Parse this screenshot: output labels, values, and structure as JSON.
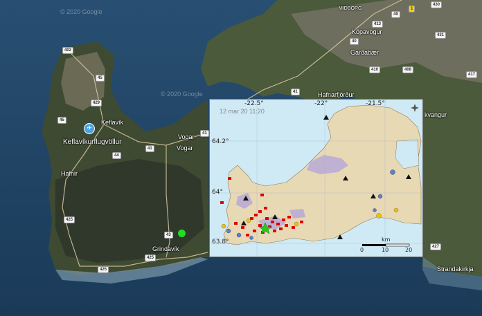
{
  "watermarks": {
    "top_left": "© 2020 Google",
    "middle": "© 2020 Google"
  },
  "places": {
    "airport": "Keflavíkurflugvöllur",
    "keflavik": "Keflavík",
    "vogar_top": "Vogar",
    "vogar": "Vogar",
    "hafnir": "Hafnir",
    "grindavik": "Grindavík",
    "hafnarfjordur": "Hafnarfjörður",
    "gardabaer": "Garðabær",
    "kopavogur": "Kópavogur",
    "midborg": "MIÐBORG",
    "kvangur": "kvangur",
    "strandakirkja": "Strandakirkja"
  },
  "roads": {
    "r402": "402",
    "r45": "45",
    "r429": "429",
    "r45b": "45",
    "r44": "44",
    "r41a": "41",
    "r41b": "41",
    "r41c": "41",
    "r43": "43",
    "r425a": "425",
    "r425b": "425",
    "r425c": "425",
    "r49": "49",
    "r1": "1",
    "r413": "413",
    "r40": "40",
    "r408": "408",
    "r410": "410",
    "r431": "431",
    "r430": "430",
    "r417": "417",
    "r427": "427"
  },
  "inset": {
    "timestamp": "12 mar 20  11:20",
    "lon_labels": [
      "-22.5°",
      "-22°",
      "-21.5°"
    ],
    "lat_labels": [
      "64.2°",
      "64°",
      "63.8°"
    ],
    "scale_unit": "km",
    "scale_ticks": [
      "0",
      "10",
      "20"
    ],
    "colors": {
      "water": "#cfe9f5",
      "land": "#e8d9b5",
      "lava": "#b9a8d6",
      "quake_recent": "#e00000",
      "quake_older": "#5b7fd6",
      "quake_mid": "#f2c200",
      "mainshock": "#22cc22",
      "station": "#111111"
    }
  }
}
